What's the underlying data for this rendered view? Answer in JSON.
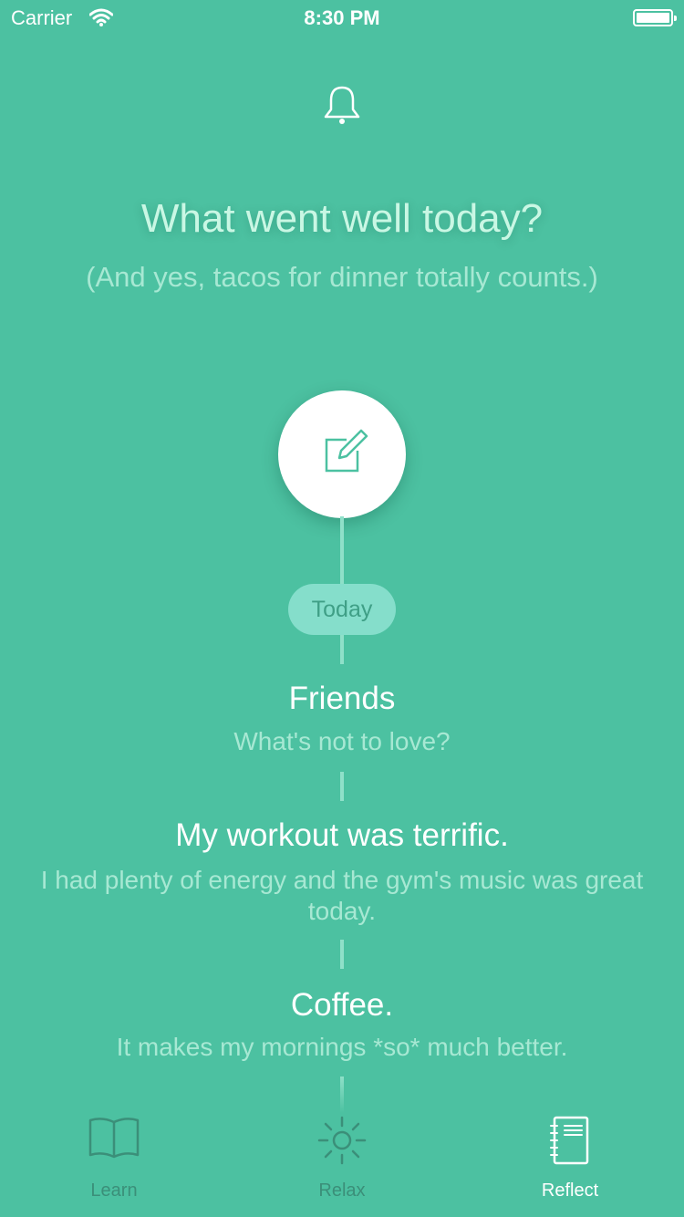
{
  "status_bar": {
    "carrier": "Carrier",
    "time": "8:30 PM"
  },
  "header": {
    "title": "What went well today?",
    "subtitle": "(And yes, tacos for dinner totally counts.)"
  },
  "timeline": {
    "date_label": "Today",
    "entries": [
      {
        "title": "Friends",
        "detail": "What's not to love?"
      },
      {
        "title": "My workout was terrific.",
        "detail": "I had plenty of energy and the gym's music was great today."
      },
      {
        "title": "Coffee.",
        "detail": "It makes my mornings *so* much better."
      }
    ]
  },
  "tabs": [
    {
      "label": "Learn",
      "icon": "book-icon"
    },
    {
      "label": "Relax",
      "icon": "sun-icon"
    },
    {
      "label": "Reflect",
      "icon": "notebook-icon",
      "active": true
    }
  ],
  "colors": {
    "background": "#4cc1a1",
    "accent": "#85decb",
    "inactive_tab": "#3b8f79"
  }
}
